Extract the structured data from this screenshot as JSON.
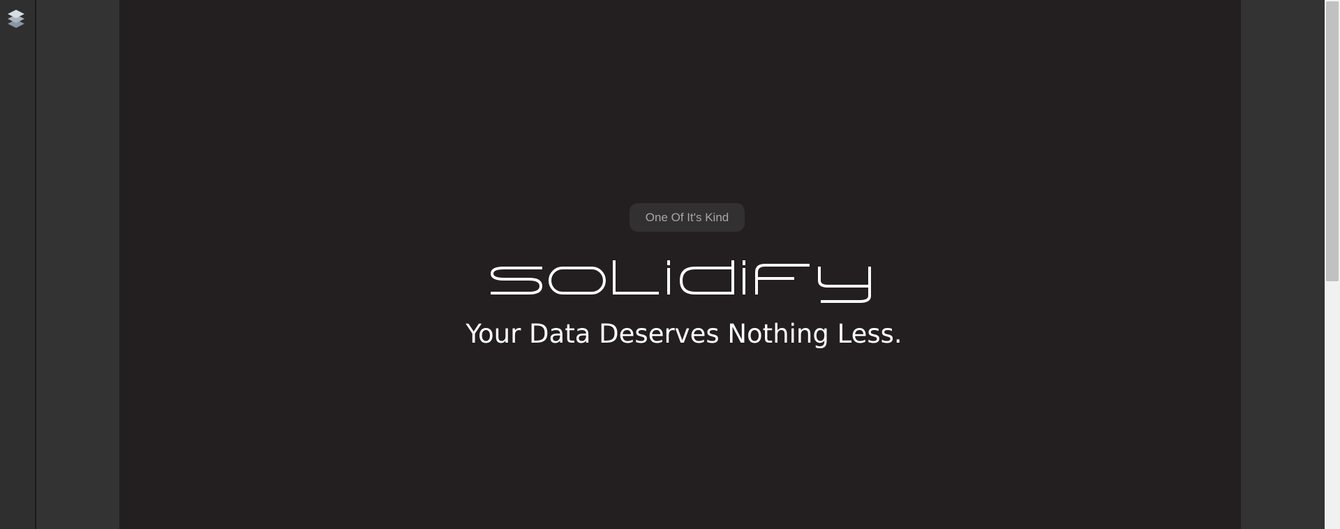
{
  "sidebar": {
    "icon": "layers-icon"
  },
  "hero": {
    "badge": "One Of It's Kind",
    "logo_text": "solidify",
    "tagline": "Your Data Deserves Nothing Less."
  },
  "colors": {
    "canvas_bg": "#231f20",
    "workspace_bg": "#333333",
    "badge_bg": "#333031",
    "badge_text": "#a9a6a7",
    "text": "#ffffff"
  }
}
